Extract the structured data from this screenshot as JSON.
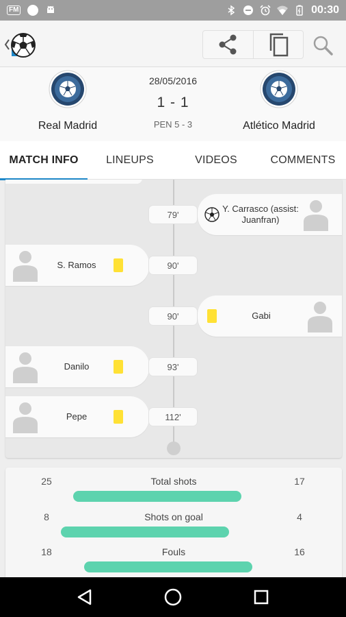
{
  "status_bar": {
    "fm_label": "FM",
    "time": "00:30",
    "icons": [
      "radio-fm-icon",
      "dot-icon",
      "android-icon",
      "bluetooth-icon",
      "do-not-disturb-icon",
      "alarm-icon",
      "wifi-icon",
      "battery-icon"
    ]
  },
  "app_bar": {
    "back_icon": "chevron-left-icon",
    "logo_icon": "soccer-ball-icon",
    "actions": [
      "share-icon",
      "copy-icon"
    ],
    "search_icon": "search-icon"
  },
  "match": {
    "date": "28/05/2016",
    "score": "1 - 1",
    "penalties": "PEN 5 - 3",
    "home_team": "Real Madrid",
    "away_team": "Atlético Madrid"
  },
  "tabs": [
    {
      "label": "MATCH INFO",
      "active": true
    },
    {
      "label": "LINEUPS",
      "active": false
    },
    {
      "label": "VIDEOS",
      "active": false
    },
    {
      "label": "COMMENTS",
      "active": false
    }
  ],
  "events": [
    {
      "side": "away",
      "minute": "79'",
      "type": "goal",
      "player": "Y. Carrasco (assist: Juanfran)"
    },
    {
      "side": "home",
      "minute": "90'",
      "type": "yellow-card",
      "player": "S. Ramos"
    },
    {
      "side": "away",
      "minute": "90'",
      "type": "yellow-card",
      "player": "Gabi"
    },
    {
      "side": "home",
      "minute": "93'",
      "type": "yellow-card",
      "player": "Danilo"
    },
    {
      "side": "home",
      "minute": "112'",
      "type": "yellow-card",
      "player": "Pepe"
    }
  ],
  "stats": [
    {
      "label": "Total shots",
      "home": "25",
      "away": "17"
    },
    {
      "label": "Shots on goal",
      "home": "8",
      "away": "4"
    },
    {
      "label": "Fouls",
      "home": "18",
      "away": "16"
    }
  ],
  "colors": {
    "accent": "#1e88c9",
    "stat_bar": "#5dd3ae",
    "yellow_card": "#ffe135",
    "status_bar": "#9e9e9e"
  },
  "nav_bar": [
    "back-triangle-icon",
    "home-circle-icon",
    "recents-square-icon"
  ]
}
